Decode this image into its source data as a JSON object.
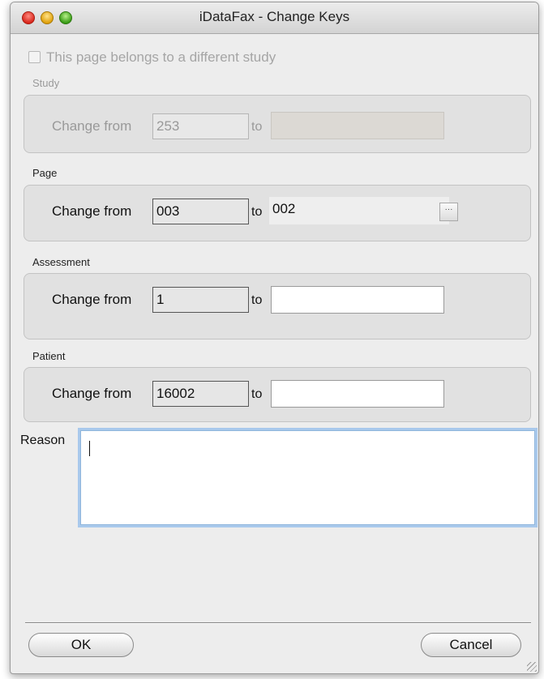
{
  "window": {
    "title": "iDataFax - Change Keys"
  },
  "different_study": {
    "label": "This page belongs to a different study",
    "checked": false
  },
  "groups": {
    "study": {
      "label": "Study",
      "change_label": "Change from",
      "from_value": "253",
      "to_label": "to",
      "to_value": "",
      "enabled": false
    },
    "page": {
      "label": "Page",
      "change_label": "Change from",
      "from_value": "003",
      "to_label": "to",
      "to_value": "002",
      "lookup_label": "···"
    },
    "assessment": {
      "label": "Assessment",
      "change_label": "Change from",
      "from_value": "1",
      "to_label": "to",
      "to_value": ""
    },
    "patient": {
      "label": "Patient",
      "change_label": "Change from",
      "from_value": "16002",
      "to_label": "to",
      "to_value": ""
    }
  },
  "reason": {
    "label": "Reason",
    "value": ""
  },
  "buttons": {
    "ok": "OK",
    "cancel": "Cancel"
  }
}
